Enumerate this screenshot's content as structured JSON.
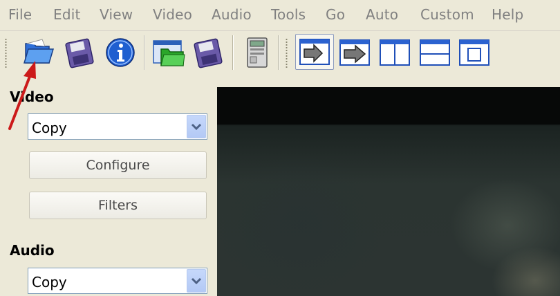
{
  "menu": [
    "File",
    "Edit",
    "View",
    "Video",
    "Audio",
    "Tools",
    "Go",
    "Auto",
    "Custom",
    "Help"
  ],
  "toolbar": {
    "buttons": [
      "open-folder",
      "save-video",
      "info",
      "open-green-folder",
      "save-audio",
      "calculator",
      "layout-a",
      "layout-b",
      "layout-c",
      "layout-d",
      "layout-e"
    ]
  },
  "video": {
    "label": "Video",
    "codec": "Copy",
    "configure_label": "Configure",
    "filters_label": "Filters"
  },
  "audio": {
    "label": "Audio",
    "codec": "Copy"
  },
  "colors": {
    "annotation_arrow": "#cc1a1a",
    "accent_blue": "#2a5fd6"
  }
}
